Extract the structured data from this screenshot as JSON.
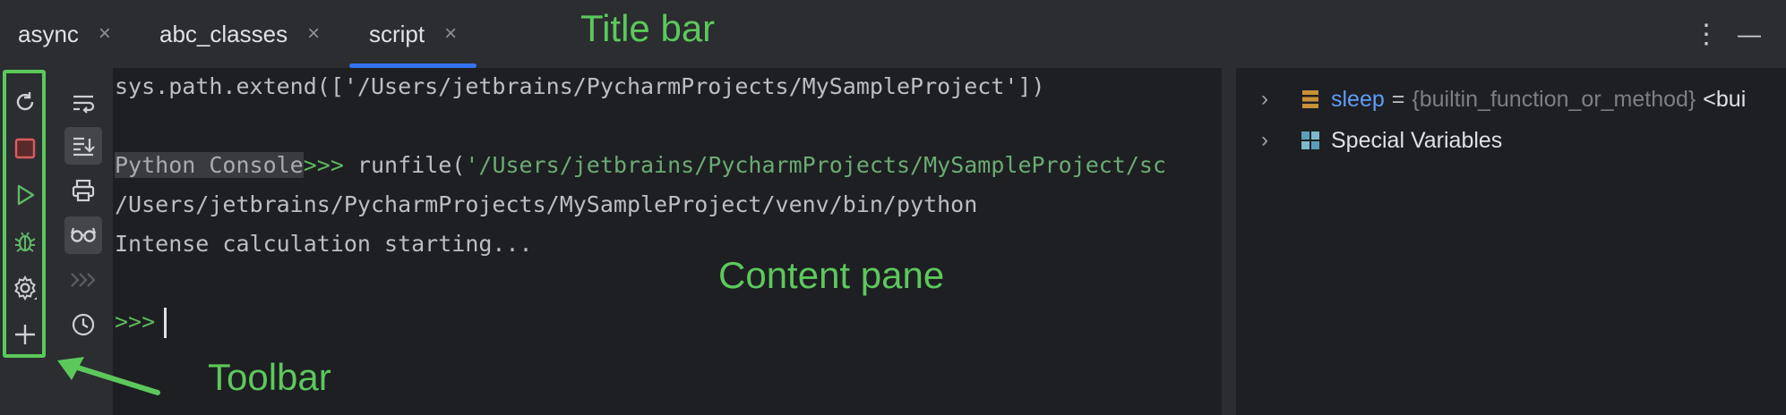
{
  "tabs": [
    {
      "label": "async",
      "active": false
    },
    {
      "label": "abc_classes",
      "active": false
    },
    {
      "label": "script",
      "active": true
    }
  ],
  "tab_close_glyph": "×",
  "window_controls": {
    "more": "⋮",
    "minimize": "—"
  },
  "toolbar": {
    "primary": [
      "rerun-icon",
      "stop-icon",
      "run-icon",
      "debug-icon",
      "settings-icon",
      "add-icon"
    ],
    "secondary": [
      "soft-wrap-icon",
      "scroll-to-end-icon",
      "print-icon",
      "show-variables-icon",
      "execute-icon",
      "history-icon"
    ]
  },
  "console": {
    "line1": "sys.path.extend(['/Users/jetbrains/PycharmProjects/MySampleProject'])",
    "line2_label": "Python Console",
    "line2_prompt": ">>>",
    "line2_cmd": " runfile(",
    "line2_str": "'/Users/jetbrains/PycharmProjects/MySampleProject/sc",
    "line3": "/Users/jetbrains/PycharmProjects/MySampleProject/venv/bin/python",
    "line4": "Intense calculation starting...",
    "prompt": ">>>"
  },
  "variables": [
    {
      "name": "sleep",
      "eq": "=",
      "type": "{builtin_function_or_method}",
      "value": "<bui"
    },
    {
      "name": "Special Variables"
    }
  ],
  "annotations": {
    "title_bar": "Title bar",
    "content_pane": "Content pane",
    "toolbar": "Toolbar"
  },
  "colors": {
    "accent": "#3574f0",
    "annotation": "#5cc85c",
    "stop": "#db5c5c",
    "run": "#5fb865",
    "string": "#6aab73"
  }
}
